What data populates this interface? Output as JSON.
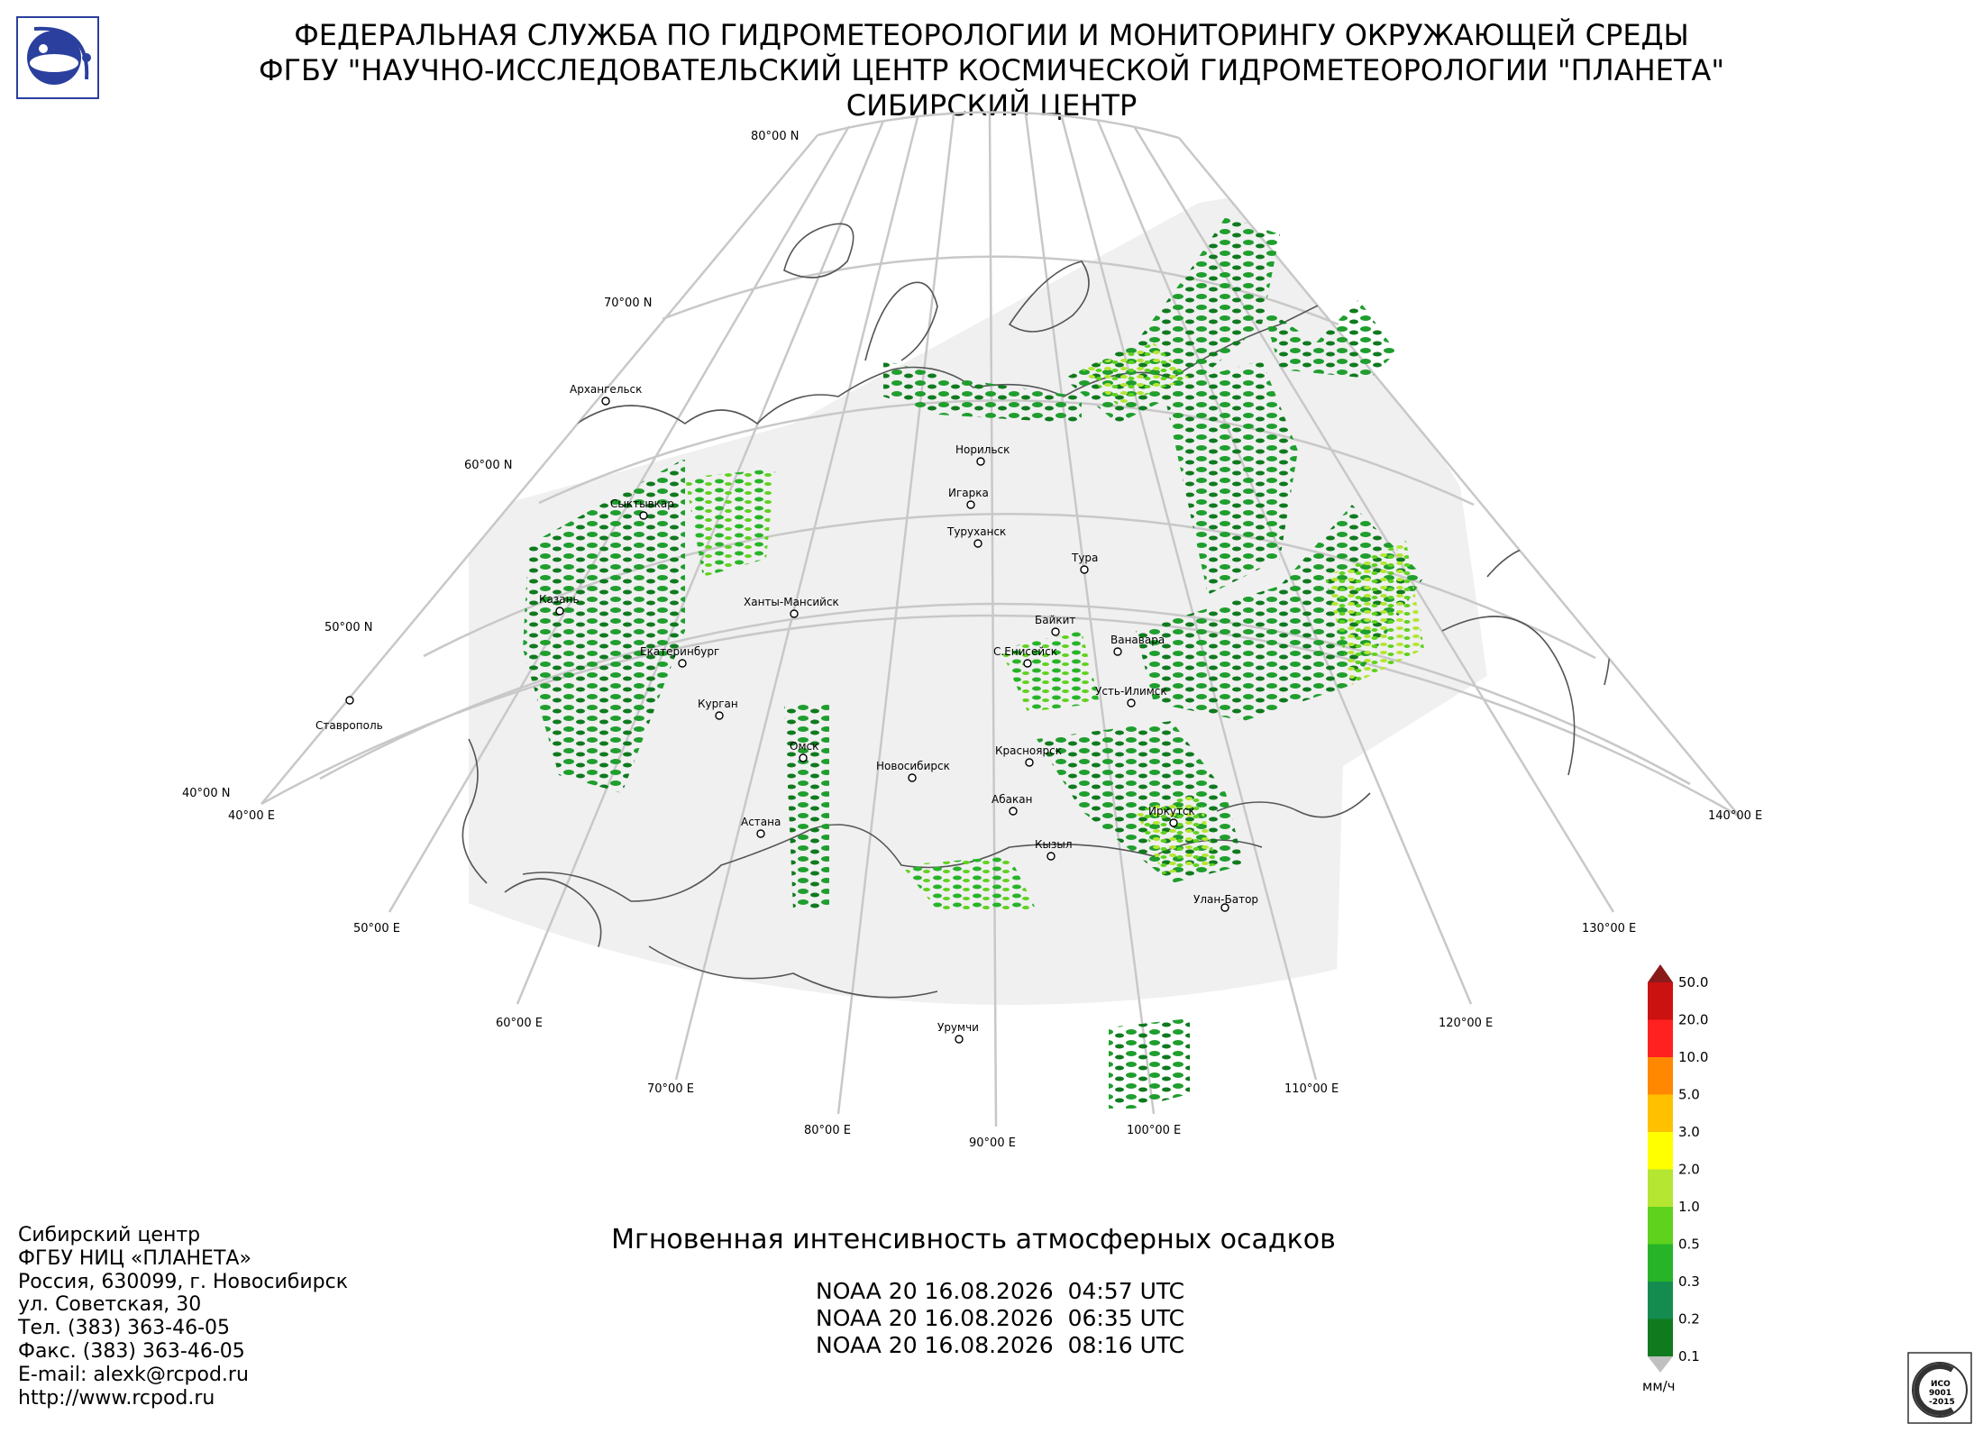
{
  "header": {
    "line1": "ФЕДЕРАЛЬНАЯ СЛУЖБА ПО ГИДРОМЕТЕОРОЛОГИИ И МОНИТОРИНГУ ОКРУЖАЮЩЕЙ СРЕДЫ",
    "line2": "ФГБУ \"НАУЧНО-ИССЛЕДОВАТЕЛЬСКИЙ ЦЕНТР КОСМИЧЕСКОЙ ГИДРОМЕТЕОРОЛОГИИ \"ПЛАНЕТА\"",
    "line3": "СИБИРСКИЙ ЦЕНТР"
  },
  "logo": {
    "icon": "planeta-logo-icon",
    "color": "#2a3f9e"
  },
  "map": {
    "lat_labels": [
      "80°00 N",
      "70°00 N",
      "60°00 N",
      "50°00 N",
      "40°00 N"
    ],
    "lon_labels": [
      "40°00 E",
      "50°00 E",
      "60°00 E",
      "70°00 E",
      "80°00 E",
      "90°00 E",
      "100°00 E",
      "110°00 E",
      "120°00 E",
      "130°00 E",
      "140°00 E"
    ],
    "cities": [
      "Архангельск",
      "Сыктывкар",
      "Казань",
      "Ставрополь",
      "Екатеринбург",
      "Курган",
      "Ханты-Мансийск",
      "Омск",
      "Астана",
      "Новосибирск",
      "Норильск",
      "Игарка",
      "Туруханск",
      "Тура",
      "Байкит",
      "Ванавара",
      "С.Енисейск",
      "Усть-Илимск",
      "Красноярск",
      "Абакан",
      "Иркутск",
      "Кызыл",
      "Улан-Батор",
      "Урумчи"
    ],
    "background_color": "#f0f0f0",
    "precip_color": "#1f9e2e"
  },
  "colorbar": {
    "levels": [
      "50.0",
      "20.0",
      "10.0",
      "5.0",
      "3.0",
      "2.0",
      "1.0",
      "0.5",
      "0.3",
      "0.2",
      "0.1"
    ],
    "colors": [
      "#8b1a1a",
      "#cc1111",
      "#ff2020",
      "#ff8800",
      "#ffc000",
      "#ffff00",
      "#b4e632",
      "#5fd21e",
      "#28b428",
      "#148c50",
      "#0f7a1e"
    ],
    "unit": "мм/ч"
  },
  "product_title": "Мгновенная интенсивность атмосферных осадков",
  "passes": [
    "NOAA 20 16.08.2026  04:57 UTC",
    "NOAA 20 16.08.2026  06:35 UTC",
    "NOAA 20 16.08.2026  08:16 UTC"
  ],
  "contact": [
    "Сибирский центр",
    "ФГБУ НИЦ «ПЛАНЕТА»",
    "Россия, 630099, г. Новосибирск",
    "ул. Советская, 30",
    "Тел. (383) 363-46-05",
    "Факс. (383) 363-46-05",
    "E-mail: alexk@rcpod.ru",
    "http://www.rcpod.ru"
  ],
  "iso_badge": [
    "ИСО",
    "9001",
    "-2015"
  ]
}
